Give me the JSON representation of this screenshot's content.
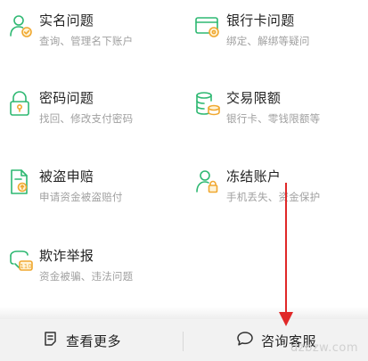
{
  "items": [
    {
      "title": "实名问题",
      "desc": "查询、管理名下账户",
      "icon": "person-check-icon"
    },
    {
      "title": "银行卡问题",
      "desc": "绑定、解绑等疑问",
      "icon": "bank-card-icon"
    },
    {
      "title": "密码问题",
      "desc": "找回、修改支付密码",
      "icon": "lock-icon"
    },
    {
      "title": "交易限额",
      "desc": "银行卡、零钱限额等",
      "icon": "coin-stack-icon"
    },
    {
      "title": "被盗申赔",
      "desc": "申请资金被盗赔付",
      "icon": "claim-document-icon"
    },
    {
      "title": "冻结账户",
      "desc": "手机丢失、资金保护",
      "icon": "person-lock-icon"
    },
    {
      "title": "欺诈举报",
      "desc": "资金被骗、违法问题",
      "icon": "report-110-icon"
    }
  ],
  "footer": {
    "more_label": "查看更多",
    "more_icon": "document-icon",
    "service_label": "咨询客服",
    "service_icon": "chat-bubble-icon"
  },
  "watermark": "dzbzw.com",
  "colors": {
    "accent": "#2eb872",
    "arrow": "#e02828"
  }
}
